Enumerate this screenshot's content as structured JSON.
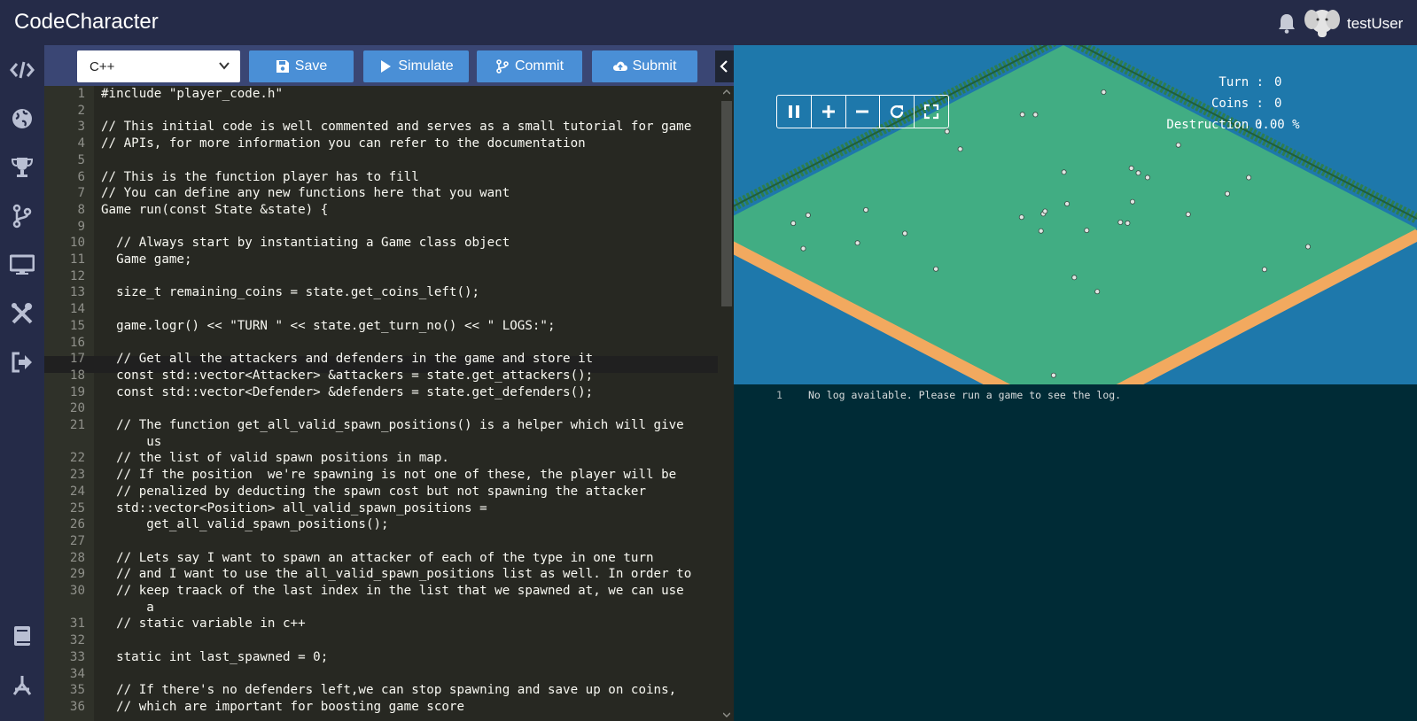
{
  "header": {
    "app_title": "CodeCharacter",
    "username": "testUser"
  },
  "sidebar": {
    "icons": [
      "code-icon",
      "globe-icon",
      "trophy-icon",
      "branch-icon",
      "monitor-icon",
      "tools-icon",
      "logout-icon",
      "book-icon",
      "network-icon"
    ]
  },
  "toolbar": {
    "language": "C++",
    "save_label": "Save",
    "simulate_label": "Simulate",
    "commit_label": "Commit",
    "submit_label": "Submit"
  },
  "editor": {
    "lines": [
      {
        "n": "1",
        "t": "#include \"player_code.h\""
      },
      {
        "n": "2",
        "t": ""
      },
      {
        "n": "3",
        "t": "// This initial code is well commented and serves as a small tutorial for game"
      },
      {
        "n": "4",
        "t": "// APIs, for more information you can refer to the documentation"
      },
      {
        "n": "5",
        "t": ""
      },
      {
        "n": "6",
        "t": "// This is the function player has to fill"
      },
      {
        "n": "7",
        "t": "// You can define any new functions here that you want"
      },
      {
        "n": "8",
        "t": "Game run(const State &state) {"
      },
      {
        "n": "9",
        "t": ""
      },
      {
        "n": "10",
        "t": "  // Always start by instantiating a Game class object"
      },
      {
        "n": "11",
        "t": "  Game game;"
      },
      {
        "n": "12",
        "t": ""
      },
      {
        "n": "13",
        "t": "  size_t remaining_coins = state.get_coins_left();"
      },
      {
        "n": "14",
        "t": ""
      },
      {
        "n": "15",
        "t": "  game.logr() << \"TURN \" << state.get_turn_no() << \" LOGS:\";"
      },
      {
        "n": "16",
        "t": ""
      },
      {
        "n": "17",
        "t": "  // Get all the attackers and defenders in the game and store it"
      },
      {
        "n": "18",
        "t": "  const std::vector<Attacker> &attackers = state.get_attackers();"
      },
      {
        "n": "19",
        "t": "  const std::vector<Defender> &defenders = state.get_defenders();"
      },
      {
        "n": "20",
        "t": ""
      },
      {
        "n": "21",
        "t": "  // The function get_all_valid_spawn_positions() is a helper which will give"
      },
      {
        "n": "",
        "t": "      us"
      },
      {
        "n": "22",
        "t": "  // the list of valid spawn positions in map."
      },
      {
        "n": "23",
        "t": "  // If the position  we're spawning is not one of these, the player will be"
      },
      {
        "n": "24",
        "t": "  // penalized by deducting the spawn cost but not spawning the attacker"
      },
      {
        "n": "25",
        "t": "  std::vector<Position> all_valid_spawn_positions ="
      },
      {
        "n": "26",
        "t": "      get_all_valid_spawn_positions();"
      },
      {
        "n": "27",
        "t": ""
      },
      {
        "n": "28",
        "t": "  // Lets say I want to spawn an attacker of each of the type in one turn"
      },
      {
        "n": "29",
        "t": "  // and I want to use the all_valid_spawn_positions list as well. In order to"
      },
      {
        "n": "30",
        "t": "  // keep traack of the last index in the list that we spawned at, we can use"
      },
      {
        "n": "",
        "t": "      a"
      },
      {
        "n": "31",
        "t": "  // static variable in c++"
      },
      {
        "n": "32",
        "t": ""
      },
      {
        "n": "33",
        "t": "  static int last_spawned = 0;"
      },
      {
        "n": "34",
        "t": ""
      },
      {
        "n": "35",
        "t": "  // If there's no defenders left,we can stop spawning and save up on coins,"
      },
      {
        "n": "36",
        "t": "  // which are important for boosting game score"
      }
    ]
  },
  "game": {
    "stats": [
      {
        "label": "Turn :",
        "value": "0"
      },
      {
        "label": "Coins :",
        "value": "0"
      },
      {
        "label": "Destruction :",
        "value": "0.00 %"
      }
    ],
    "colors": {
      "water": "#1e78ab",
      "grass": "#41ad83",
      "sand": "#f2a95f",
      "hedge": "#2e7d4f"
    }
  },
  "log": {
    "line_no": "1",
    "text": "No log available. Please run a game to see the log."
  }
}
